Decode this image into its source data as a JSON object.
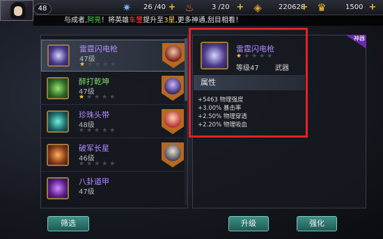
{
  "player": {
    "level": "48"
  },
  "topbar": {
    "stamina": {
      "icon": "stamina-icon",
      "value": "26 /40"
    },
    "energy": {
      "icon": "energy-icon",
      "value": "3 /20"
    },
    "coins": {
      "icon": "coin-icon",
      "value": "220628"
    },
    "gold": {
      "icon": "gold-ingot-icon",
      "value": "1500"
    }
  },
  "marquee": {
    "prefix": "与成者,",
    "player_name": "阿亮",
    "mid1": "！将英雄",
    "hero_name": "车璽",
    "mid2": "提升至",
    "stars": "3星",
    "suffix": ",更多神通,刮目相看！"
  },
  "items": [
    {
      "name": "雷霆闪电枪",
      "level": "47级",
      "stars_on": "★",
      "stars_off": "★★★★",
      "color": "purple",
      "icon": "lightning-spear-icon",
      "hero": "hero-portrait-1"
    },
    {
      "name": "醉打乾坤",
      "level": "47级",
      "stars_on": "★",
      "stars_off": "★★★★",
      "color": "green",
      "icon": "gourd-icon",
      "hero": "hero-portrait-2"
    },
    {
      "name": "珍珠头带",
      "level": "48级",
      "stars_on": "",
      "stars_off": "★★★★★",
      "color": "purple",
      "icon": "headband-icon",
      "hero": "hero-portrait-3"
    },
    {
      "name": "破军长星",
      "level": "46级",
      "stars_on": "",
      "stars_off": "★★★★★",
      "color": "purple",
      "icon": "mace-icon",
      "hero": "hero-portrait-4"
    },
    {
      "name": "八卦道甲",
      "level": "47级",
      "stars_on": "",
      "stars_off": "",
      "color": "purple",
      "icon": "armor-icon",
      "hero": ""
    }
  ],
  "detail": {
    "corner_tag": "神器",
    "name": "雷霆闪电枪",
    "stars_on": "★",
    "stars_off": "★★★★",
    "level": "等级47",
    "type": "武器",
    "attr_title": "属性",
    "attributes": [
      "+5463 物理强度",
      "+3.00% 暴击率",
      "+2.50% 物理穿透",
      "+2.20% 物理吸血"
    ]
  },
  "buttons": {
    "filter": "筛选",
    "upgrade": "升级",
    "enhance": "强化"
  },
  "colors": {
    "highlight_frame": "#e8202a",
    "purple_name": "#b28cff",
    "green_name": "#7fe06a",
    "button": "#2f7a72"
  }
}
